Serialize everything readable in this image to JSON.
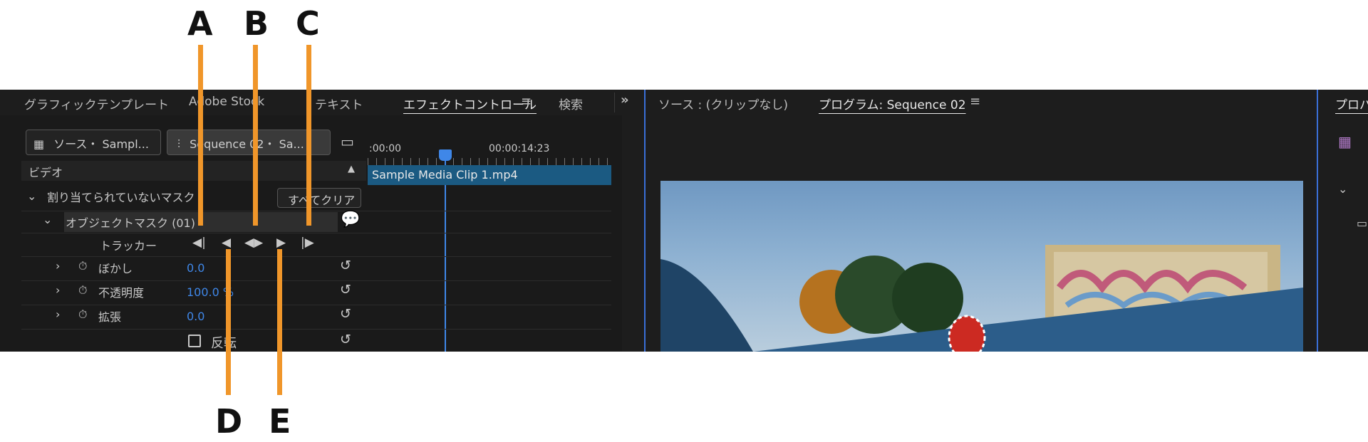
{
  "callouts": {
    "A": "A",
    "B": "B",
    "C": "C",
    "D": "D",
    "E": "E"
  },
  "left_panel": {
    "tabs": [
      {
        "label": "グラフィックテンプレート"
      },
      {
        "label": "Adobe Stock"
      },
      {
        "label": "テキスト"
      },
      {
        "label": "エフェクトコントロール",
        "active": true
      },
      {
        "label": "検索"
      }
    ],
    "more_icon": "double-chevron-right-icon",
    "menu_icon": "hamburger-icon",
    "source_tab": "ソース・ Sampl...",
    "sequence_tab": "Sequence 02・ Sa...",
    "section_header": "ビデオ",
    "unassigned_mask": "割り当てられていないマスク",
    "clear_all_button": "すべてクリア",
    "object_mask": "オブジェクトマスク (01)",
    "tracker_label": "トラッカー",
    "properties": [
      {
        "label": "ぼかし",
        "value": "0.0"
      },
      {
        "label": "不透明度",
        "value": "100.0 %"
      },
      {
        "label": "拡張",
        "value": "0.0"
      }
    ],
    "invert_label": "反転"
  },
  "timeline": {
    "start_time": ":00:00",
    "end_time": "00:00:14:23",
    "clip_name": "Sample Media Clip 1.mp4"
  },
  "right_panel": {
    "source_tab": "ソース : (クリップなし)",
    "program_tab": "プログラム: Sequence 02",
    "next_tab": "プロパ"
  },
  "colors": {
    "accent": "#3f87e8",
    "callout": "#f0962a",
    "clip_bg": "#1b5a82",
    "panel_bg": "#1d1d1d"
  }
}
